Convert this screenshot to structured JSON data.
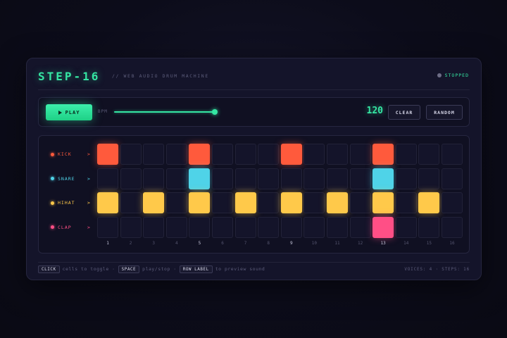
{
  "header": {
    "title": "STEP-16",
    "subtitle": "// WEB AUDIO DRUM MACHINE",
    "status": "STOPPED"
  },
  "controls": {
    "play_label": "PLAY",
    "bpm_label": "BPM",
    "bpm": 120,
    "bpm_slider_fraction": 0.98,
    "clear_label": "CLEAR",
    "random_label": "RANDOM"
  },
  "tracks": [
    {
      "name": "KICK",
      "arrow": ">",
      "color": "#ff5a3c",
      "steps": [
        1,
        0,
        0,
        0,
        1,
        0,
        0,
        0,
        1,
        0,
        0,
        0,
        1,
        0,
        0,
        0
      ]
    },
    {
      "name": "SNARE",
      "arrow": ">",
      "color": "#4fd3e8",
      "steps": [
        0,
        0,
        0,
        0,
        1,
        0,
        0,
        0,
        0,
        0,
        0,
        0,
        1,
        0,
        0,
        0
      ]
    },
    {
      "name": "HIHAT",
      "arrow": ">",
      "color": "#ffc94a",
      "steps": [
        1,
        0,
        1,
        0,
        1,
        0,
        1,
        0,
        1,
        0,
        1,
        0,
        1,
        0,
        1,
        0
      ]
    },
    {
      "name": "CLAP",
      "arrow": ">",
      "color": "#ff4f86",
      "steps": [
        0,
        0,
        0,
        0,
        0,
        0,
        0,
        0,
        0,
        0,
        0,
        0,
        1,
        0,
        0,
        0
      ]
    }
  ],
  "step_numbers": [
    "1",
    "2",
    "3",
    "4",
    "5",
    "6",
    "7",
    "8",
    "9",
    "10",
    "11",
    "12",
    "13",
    "14",
    "15",
    "16"
  ],
  "footer": {
    "key_click": "CLICK",
    "text_click": "cells to toggle ·",
    "key_space": "SPACE",
    "text_space": "play/stop ·",
    "key_row": "ROW LABEL",
    "text_row": "to preview sound",
    "stats": "VOICES: 4 · STEPS: 16"
  },
  "colors": {
    "accent": "#35e6a3",
    "status_dot": "#6d6d86"
  },
  "icons": {
    "play": "play-triangle-icon",
    "status": "status-dot-icon"
  }
}
